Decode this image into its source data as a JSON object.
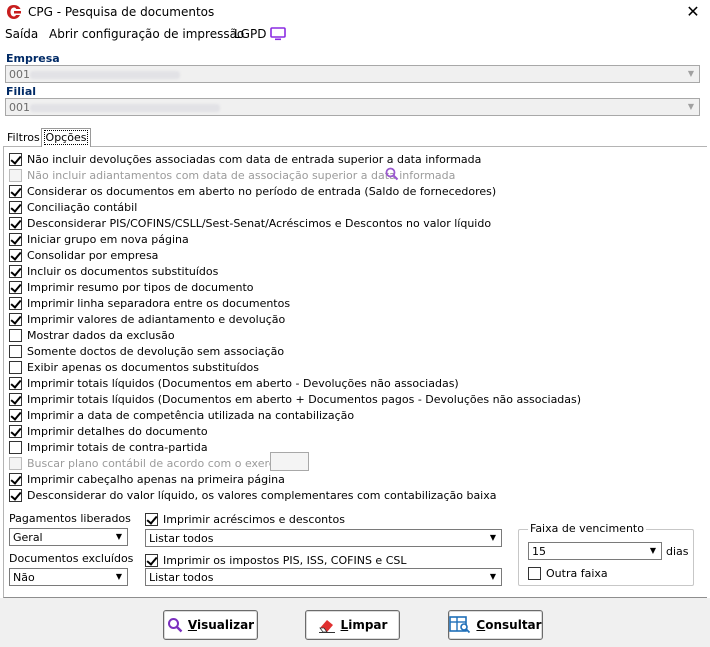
{
  "window": {
    "title": "CPG - Pesquisa de documentos",
    "close_label": "✕"
  },
  "menu": {
    "saida": "Saída",
    "config": "Abrir configuração de impressão",
    "lgpd": "LGPD"
  },
  "empresa": {
    "label": "Empresa",
    "code": "001"
  },
  "filial": {
    "label": "Filial",
    "code": "001"
  },
  "tabs": {
    "filtros": "Filtros",
    "opcoes": "Opções"
  },
  "options": [
    {
      "label": "Não incluir devoluções associadas com data de entrada superior a data informada",
      "checked": true,
      "enabled": true
    },
    {
      "label": "Não incluir adiantamentos com data de associação superior a data informada",
      "checked": false,
      "enabled": false
    },
    {
      "label": "Considerar os documentos em aberto no período de entrada (Saldo de fornecedores)",
      "checked": true,
      "enabled": true
    },
    {
      "label": "Conciliação contábil",
      "checked": true,
      "enabled": true
    },
    {
      "label": "Desconsiderar PIS/COFINS/CSLL/Sest-Senat/Acréscimos e Descontos no valor líquido",
      "checked": true,
      "enabled": true
    },
    {
      "label": "Iniciar grupo em nova página",
      "checked": true,
      "enabled": true
    },
    {
      "label": "Consolidar por empresa",
      "checked": true,
      "enabled": true
    },
    {
      "label": "Incluir os documentos substituídos",
      "checked": true,
      "enabled": true
    },
    {
      "label": "Imprimir resumo por tipos de documento",
      "checked": true,
      "enabled": true
    },
    {
      "label": "Imprimir linha separadora entre os documentos",
      "checked": true,
      "enabled": true
    },
    {
      "label": "Imprimir valores de adiantamento e devolução",
      "checked": true,
      "enabled": true
    },
    {
      "label": "Mostrar dados da exclusão",
      "checked": false,
      "enabled": true
    },
    {
      "label": "Somente doctos de devolução sem associação",
      "checked": false,
      "enabled": true
    },
    {
      "label": "Exibir apenas os documentos substituídos",
      "checked": false,
      "enabled": true
    },
    {
      "label": "Imprimir totais líquidos (Documentos em aberto - Devoluções não associadas)",
      "checked": true,
      "enabled": true
    },
    {
      "label": "Imprimir totais líquidos (Documentos em aberto + Documentos pagos - Devoluções não associadas)",
      "checked": true,
      "enabled": true
    },
    {
      "label": "Imprimir a data de competência utilizada na contabilização",
      "checked": true,
      "enabled": true
    },
    {
      "label": "Imprimir detalhes do documento",
      "checked": true,
      "enabled": true
    },
    {
      "label": "Imprimir totais de contra-partida",
      "checked": false,
      "enabled": true
    },
    {
      "label": "Buscar plano contábil de acordo com o exercício:",
      "checked": false,
      "enabled": false
    },
    {
      "label": "Imprimir cabeçalho apenas na primeira página",
      "checked": true,
      "enabled": true
    },
    {
      "label": "Desconsiderar do valor líquido, os valores complementares com contabilização baixa",
      "checked": true,
      "enabled": true
    }
  ],
  "pagamentos": {
    "label": "Pagamentos liberados",
    "value": "Geral"
  },
  "documentos_excluidos": {
    "label": "Documentos excluídos",
    "value": "Não"
  },
  "acrescimos": {
    "label": "Imprimir acréscimos e descontos",
    "checked": true,
    "value": "Listar todos"
  },
  "impostos": {
    "label": "Imprimir os impostos PIS, ISS, COFINS e CSL",
    "checked": true,
    "value": "Listar todos"
  },
  "faixa": {
    "title": "Faixa de vencimento",
    "value": "15",
    "unit": "dias",
    "outra_label": "Outra faixa",
    "outra_checked": false
  },
  "buttons": {
    "visualizar_first": "V",
    "visualizar_rest": "isualizar",
    "limpar_first": "L",
    "limpar_rest": "impar",
    "consultar_first": "C",
    "consultar_rest": "onsultar"
  },
  "colors": {
    "label_blue": "#002a66",
    "logo_red": "#c81e1e",
    "lgpd_purple": "#8a2be2",
    "search_purple": "#9b59d0"
  }
}
